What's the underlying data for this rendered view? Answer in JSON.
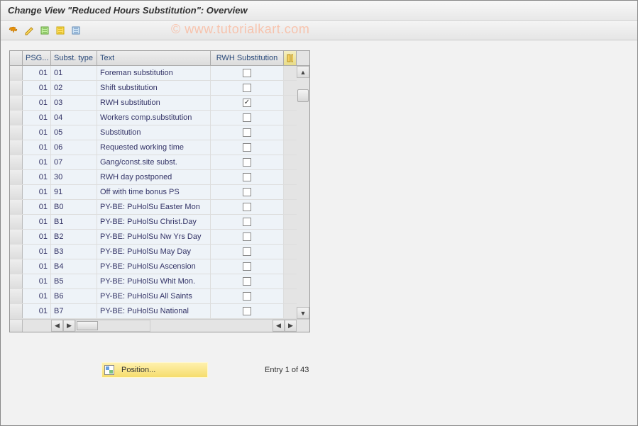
{
  "title": "Change View \"Reduced Hours Substitution\": Overview",
  "watermark": "© www.tutorialkart.com",
  "columns": {
    "psg": "PSG...",
    "subst": "Subst. type",
    "text": "Text",
    "rwh": "RWH Substitution"
  },
  "rows": [
    {
      "psg": "01",
      "sub": "01",
      "text": "Foreman substitution",
      "rwh": false
    },
    {
      "psg": "01",
      "sub": "02",
      "text": "Shift substitution",
      "rwh": false
    },
    {
      "psg": "01",
      "sub": "03",
      "text": "RWH substitution",
      "rwh": true
    },
    {
      "psg": "01",
      "sub": "04",
      "text": "Workers comp.substitution",
      "rwh": false
    },
    {
      "psg": "01",
      "sub": "05",
      "text": "Substitution",
      "rwh": false
    },
    {
      "psg": "01",
      "sub": "06",
      "text": "Requested working time",
      "rwh": false
    },
    {
      "psg": "01",
      "sub": "07",
      "text": "Gang/const.site subst.",
      "rwh": false
    },
    {
      "psg": "01",
      "sub": "30",
      "text": "RWH day postponed",
      "rwh": false
    },
    {
      "psg": "01",
      "sub": "91",
      "text": "Off with time bonus PS",
      "rwh": false
    },
    {
      "psg": "01",
      "sub": "B0",
      "text": "PY-BE: PuHolSu Easter Mon",
      "rwh": false
    },
    {
      "psg": "01",
      "sub": "B1",
      "text": "PY-BE: PuHolSu Christ.Day",
      "rwh": false
    },
    {
      "psg": "01",
      "sub": "B2",
      "text": "PY-BE: PuHolSu Nw Yrs Day",
      "rwh": false
    },
    {
      "psg": "01",
      "sub": "B3",
      "text": "PY-BE: PuHolSu May Day",
      "rwh": false
    },
    {
      "psg": "01",
      "sub": "B4",
      "text": "PY-BE: PuHolSu Ascension",
      "rwh": false
    },
    {
      "psg": "01",
      "sub": "B5",
      "text": "PY-BE: PuHolSu Whit Mon.",
      "rwh": false
    },
    {
      "psg": "01",
      "sub": "B6",
      "text": "PY-BE: PuHolSu All Saints",
      "rwh": false
    },
    {
      "psg": "01",
      "sub": "B7",
      "text": "PY-BE: PuHolSu National",
      "rwh": false
    }
  ],
  "footer": {
    "position_label": "Position...",
    "entry_text": "Entry 1 of 43"
  }
}
